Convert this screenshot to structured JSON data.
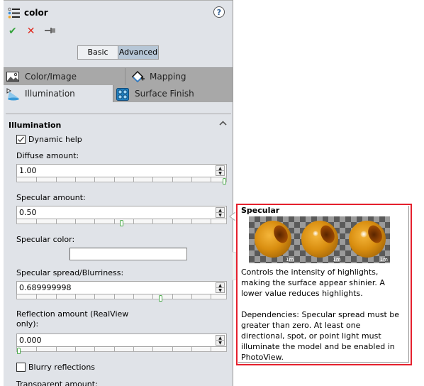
{
  "header": {
    "title": "color",
    "icon": "property-list-icon",
    "help_icon": "help-icon",
    "help_glyph": "?"
  },
  "actions": {
    "ok_glyph": "✔",
    "cancel_glyph": "✕",
    "pin_glyph": "⊣"
  },
  "mode": {
    "basic": "Basic",
    "advanced": "Advanced",
    "selected": "Advanced"
  },
  "tabs": [
    {
      "label": "Color/Image",
      "icon": "image-icon",
      "active": false
    },
    {
      "label": "Mapping",
      "icon": "mapping-icon",
      "active": false
    },
    {
      "label": "Illumination",
      "icon": "light-icon",
      "active": true
    },
    {
      "label": "Surface Finish",
      "icon": "surface-finish-icon",
      "active": false
    }
  ],
  "section": {
    "title": "Illumination",
    "collapse_glyph": "^"
  },
  "dynamic_help": {
    "label": "Dynamic help",
    "checked": true,
    "check_glyph": "✓"
  },
  "fields": [
    {
      "label": "Diffuse amount:",
      "value": "1.00",
      "slider_fraction": 1.0
    },
    {
      "label": "Specular amount:",
      "value": "0.50",
      "slider_fraction": 0.5
    },
    {
      "label": "Specular spread/Blurriness:",
      "value": "0.689999998",
      "slider_fraction": 0.69
    },
    {
      "label": "Reflection amount (RealView only):",
      "value": "0.000",
      "slider_fraction": 0.0
    }
  ],
  "specular_color": {
    "label": "Specular color:",
    "color": "#ffffff"
  },
  "blurry_reflections": {
    "label": "Blurry reflections",
    "checked": false
  },
  "transparent_amount": {
    "label": "Transparent amount:"
  },
  "spin": {
    "up": "▲",
    "down": "▼"
  },
  "tooltip": {
    "title": "Specular",
    "image_tags": [
      "1m",
      "1m",
      "1m"
    ],
    "text": "Controls the intensity of highlights,\n making the surface appear shinier. A\n lower value reduces highlights.\n\nDependencies: Specular spread must be\n greater than zero.  At least one\n directional, spot, or point light must\n illuminate the model and be enabled in\n PhotoView.",
    "border_color": "#e5202d"
  }
}
